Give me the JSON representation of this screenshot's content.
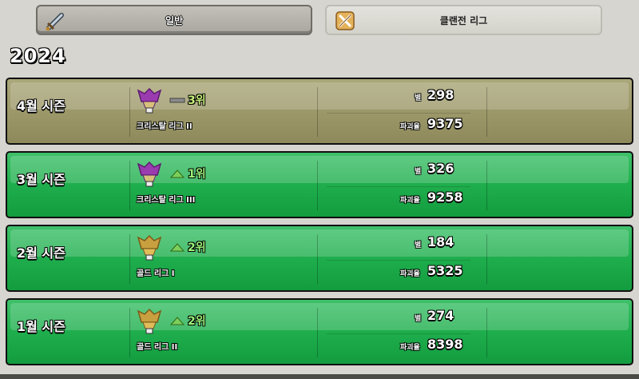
{
  "tabs": {
    "general": {
      "label": "일반",
      "icon": "sword-icon"
    },
    "clan": {
      "label": "클랜전 리그",
      "icon": "crossed-swords-icon"
    }
  },
  "year": "2024",
  "seasons": [
    {
      "name": "4월 시즌",
      "league": "크리스탈 리그 II",
      "league_tier": "crystal",
      "tier_numeral": "II",
      "rank": "3위",
      "rank_change": "same",
      "stars_label": "별",
      "stars": "298",
      "destruction_label": "파괴율",
      "destruction": "9375",
      "background": "gold"
    },
    {
      "name": "3월 시즌",
      "league": "크리스탈 리그 III",
      "league_tier": "crystal",
      "tier_numeral": "III",
      "rank": "1위",
      "rank_change": "up",
      "stars_label": "별",
      "stars": "326",
      "destruction_label": "파괴율",
      "destruction": "9258",
      "background": "green"
    },
    {
      "name": "2월 시즌",
      "league": "골드 리그 I",
      "league_tier": "gold",
      "tier_numeral": "I",
      "rank": "2위",
      "rank_change": "up",
      "stars_label": "별",
      "stars": "184",
      "destruction_label": "파괴율",
      "destruction": "5325",
      "background": "green"
    },
    {
      "name": "1월 시즌",
      "league": "골드 리그 II",
      "league_tier": "gold",
      "tier_numeral": "II",
      "rank": "2위",
      "rank_change": "up",
      "stars_label": "별",
      "stars": "274",
      "destruction_label": "파괴율",
      "destruction": "8398",
      "background": "green"
    }
  ],
  "colors": {
    "gold_card": "#9b9768",
    "green_card": "#1fae4d",
    "crystal_league": "#9b3bb0",
    "gold_league": "#c9a040",
    "rank_up": "#7ccf5a",
    "rank_same": "#777777"
  }
}
